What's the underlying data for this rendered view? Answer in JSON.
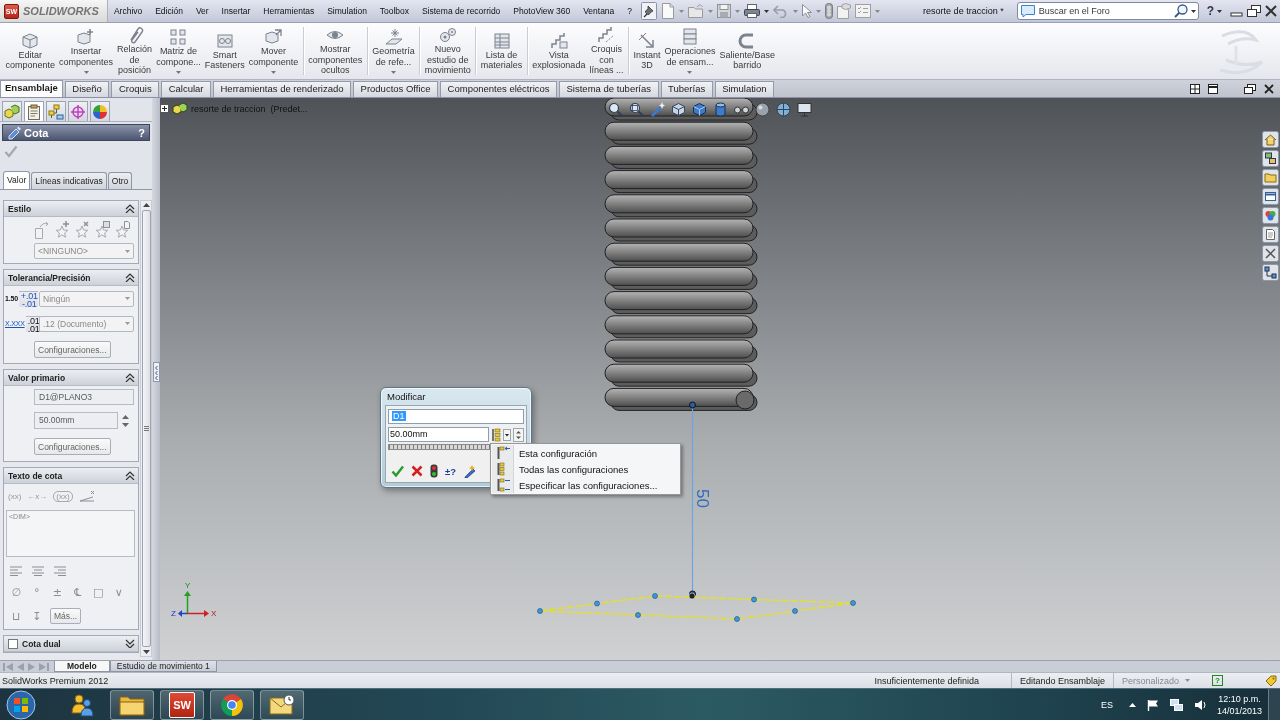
{
  "title_bar": {
    "logo_mark": "SW",
    "logo_text": "SOLIDWORKS",
    "menu": [
      "Archivo",
      "Edición",
      "Ver",
      "Insertar",
      "Herramientas",
      "Simulation",
      "Toolbox",
      "Sistema de recorrido",
      "PhotoView 360",
      "Ventana",
      "?"
    ],
    "document_title": "resorte de traccion *",
    "search": {
      "placeholder": "Buscar en el Foro"
    },
    "help": "?"
  },
  "toolbar": [
    [
      {
        "label": "Editar\ncomponente",
        "dropdown": false
      },
      {
        "label": "Insertar\ncomponentes",
        "dropdown": true
      },
      {
        "label": "Relación\nde\nposición",
        "dropdown": false
      },
      {
        "label": "Matriz de\ncompone...",
        "dropdown": true
      },
      {
        "label": "Smart\nFasteners",
        "dropdown": false
      },
      {
        "label": "Mover\ncomponente",
        "dropdown": true
      }
    ],
    [
      {
        "label": "Mostrar\ncomponentes\nocultos",
        "dropdown": false
      }
    ],
    [
      {
        "label": "Geometría\nde refe...",
        "dropdown": true
      }
    ],
    [
      {
        "label": "Nuevo\nestudio de\nmovimiento",
        "dropdown": false
      }
    ],
    [
      {
        "label": "Lista de\nmateriales",
        "dropdown": false
      }
    ],
    [
      {
        "label": "Vista\nexplosionada",
        "dropdown": false
      },
      {
        "label": "Croquis\ncon\nlíneas ...",
        "dropdown": false
      }
    ],
    [
      {
        "label": "Instant\n3D",
        "dropdown": false
      },
      {
        "label": "Operaciones\nde ensam...",
        "dropdown": true
      },
      {
        "label": "Saliente/Base\nbarrido",
        "dropdown": false
      }
    ]
  ],
  "tabs": [
    {
      "label": "Ensamblaje",
      "selected": true
    },
    {
      "label": "Diseño",
      "selected": false
    },
    {
      "label": "Croquis",
      "selected": false
    },
    {
      "label": "Calcular",
      "selected": false
    },
    {
      "label": "Herramientas de renderizado",
      "selected": false
    },
    {
      "label": "Productos Office",
      "selected": false
    },
    {
      "label": "Componentes eléctricos",
      "selected": false
    },
    {
      "label": "Sistema de tuberías",
      "selected": false
    },
    {
      "label": "Tuberías",
      "selected": false
    },
    {
      "label": "Simulation",
      "selected": false
    }
  ],
  "property_manager": {
    "panel_tabs": [
      {
        "selected": false
      },
      {
        "selected": true
      },
      {
        "selected": false
      },
      {
        "selected": false
      },
      {
        "selected": false
      }
    ],
    "title": "Cota",
    "help": "?",
    "confirm_disabled": true,
    "tabs": [
      {
        "label": "Valor",
        "selected": true
      },
      {
        "label": "Líneas indicativas",
        "selected": false
      },
      {
        "label": "Otro",
        "selected": false
      }
    ],
    "groups": [
      {
        "kind": "style",
        "title": "Estilo",
        "expanded": true,
        "select": "<NINGUNO>"
      },
      {
        "kind": "tolerance",
        "title": "Tolerancia/Precisión",
        "expanded": true,
        "rows": [
          {
            "symbol": {
              "main": "1.50",
              "upper": "+.01",
              "lower": "-.01"
            },
            "select": "Ningún"
          },
          {
            "symbol": {
              "main": "X.XXX",
              "upper": ".01",
              "lower": ".01"
            },
            "select": ".12 (Documento)"
          }
        ],
        "button": "Configuraciones..."
      },
      {
        "kind": "primary",
        "title": "Valor primario",
        "expanded": true,
        "disabled": true,
        "name": "D1@PLANO3",
        "value": "50.00mm",
        "button": "Configuraciones..."
      },
      {
        "kind": "text",
        "title": "Texto de cota",
        "expanded": true,
        "formats": [
          "(xx)",
          "←x→",
          "(xx)"
        ],
        "text": "<DIM>",
        "symbols": [
          "∅",
          "°",
          "±",
          "℄",
          "□",
          "∨"
        ],
        "symbols_2": [
          "⊔",
          "↧"
        ],
        "more": "Más..."
      },
      {
        "kind": "dual",
        "title": "Cota dual",
        "expanded": false,
        "checked": false
      }
    ]
  },
  "viewport": {
    "tree": {
      "label": "resorte de traccion  (Predet...",
      "expanded": false
    },
    "dimension": {
      "value": "50"
    },
    "triad": [
      {
        "kind": "y",
        "label": "Y"
      },
      {
        "kind": "z",
        "label": "Z"
      },
      {
        "kind": "x",
        "label": "X"
      }
    ]
  },
  "modify_dialog": {
    "title": "Modificar",
    "name": "D1",
    "name_selected": true,
    "value": "50.00mm",
    "buttons": [
      {
        "kind": "ok"
      },
      {
        "kind": "cancel"
      },
      {
        "kind": "rebuild"
      },
      {
        "kind": "tolerance",
        "label": "±?"
      },
      {
        "kind": "mark"
      }
    ]
  },
  "context_menu": [
    {
      "kind": "this",
      "label": "Esta configuración"
    },
    {
      "kind": "all",
      "label": "Todas las configuraciones"
    },
    {
      "kind": "specify",
      "label": "Especificar las configuraciones..."
    }
  ],
  "bottom_tabs": [
    {
      "label": "Modelo",
      "selected": true
    },
    {
      "label": "Estudio de movimiento 1",
      "selected": false
    }
  ],
  "status_bar": {
    "product": "SolidWorks Premium 2012",
    "fields": [
      {
        "label": "Insuficientemente definida",
        "disabled": false,
        "dropdown": false
      },
      {
        "label": "Editando Ensamblaje",
        "disabled": false,
        "dropdown": false
      },
      {
        "label": "Personalizado",
        "disabled": true,
        "dropdown": true
      }
    ],
    "help": "?"
  },
  "taskbar": {
    "apps": [
      {
        "kind": "contacts",
        "running": false
      },
      {
        "kind": "folder",
        "running": true
      },
      {
        "kind": "solidworks",
        "label": "SW",
        "running": true
      },
      {
        "kind": "browser",
        "running": true
      },
      {
        "kind": "mail",
        "running": true
      }
    ],
    "language": "ES",
    "time": "12:10 p.m.",
    "date": "14/01/2013"
  }
}
